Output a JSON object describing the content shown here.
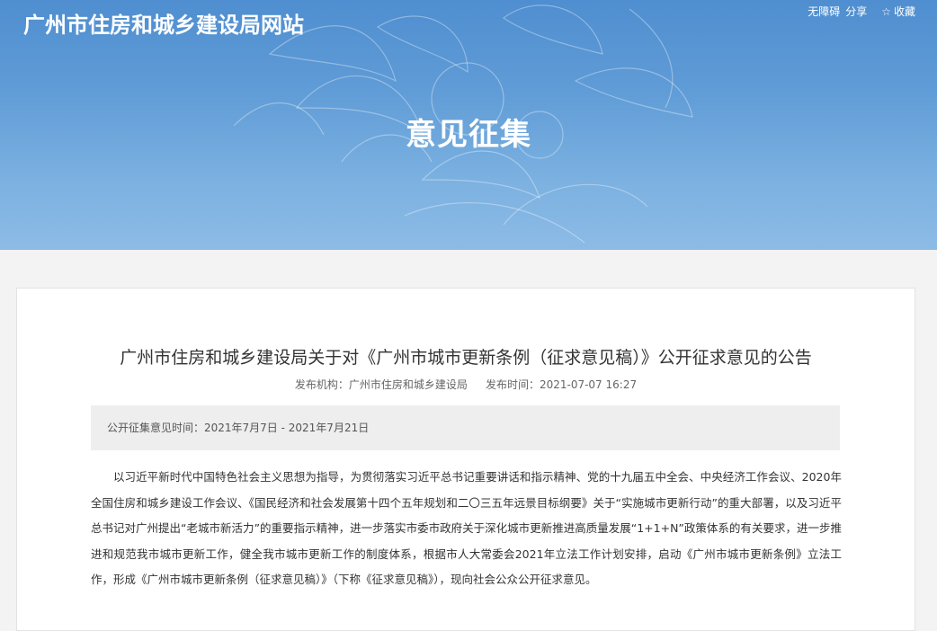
{
  "header": {
    "site_title": "广州市住房和城乡建设局网站",
    "links": {
      "accessibility": "无障碍",
      "share": "分享",
      "favorite": "收藏"
    },
    "favorite_icon": "star-outline-icon",
    "page_heading": "意见征集"
  },
  "article": {
    "title": "广州市住房和城乡建设局关于对《广州市城市更新条例（征求意见稿）》公开征求意见的公告",
    "publisher_label": "发布机构：",
    "publisher": "广州市住房和城乡建设局",
    "time_label": "发布时间：",
    "time": "2021-07-07 16:27",
    "period": "公开征集意见时间：2021年7月7日 - 2021年7月21日",
    "body": "以习近平新时代中国特色社会主义思想为指导，为贯彻落实习近平总书记重要讲话和指示精神、党的十九届五中全会、中央经济工作会议、2020年全国住房和城乡建设工作会议、《国民经济和社会发展第十四个五年规划和二〇三五年远景目标纲要》关于“实施城市更新行动”的重大部署，以及习近平总书记对广州提出“老城市新活力”的重要指示精神，进一步落实市委市政府关于深化城市更新推进高质量发展“1+1+N”政策体系的有关要求，进一步推进和规范我市城市更新工作，健全我市城市更新工作的制度体系，根据市人大常委会2021年立法工作计划安排，启动《广州市城市更新条例》立法工作，形成《广州市城市更新条例（征求意见稿）》（下称《征求意见稿》），现向社会公众公开征求意见。"
  },
  "colors": {
    "banner_top": "#4f8ed0",
    "banner_bottom": "#8dbbe6",
    "page_bg": "#f3f3f3",
    "period_bg": "#eeeeee"
  }
}
